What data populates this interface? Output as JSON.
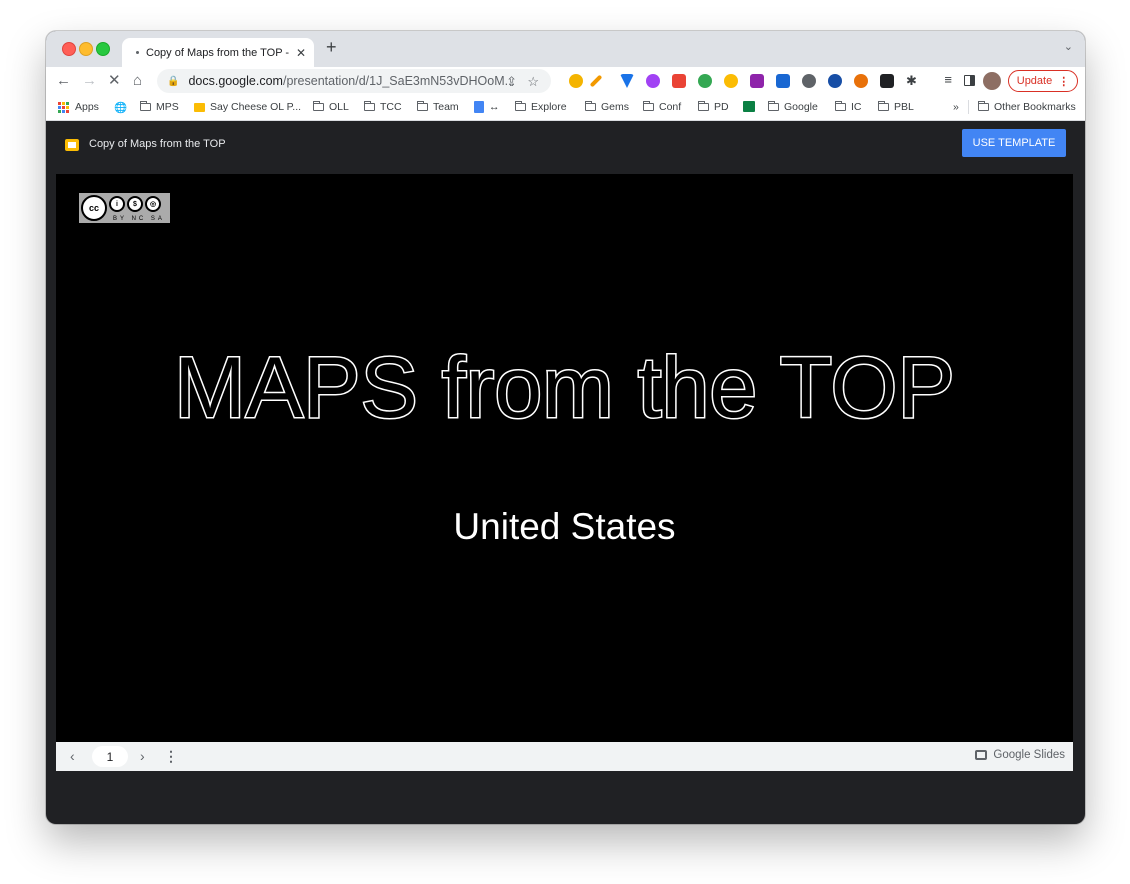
{
  "browser": {
    "tab_title": "Copy of Maps from the TOP - G",
    "tab_close": "✕",
    "new_tab": "+",
    "tab_menu": "⌄",
    "url_host": "docs.google.com",
    "url_path": "/presentation/d/1J_SaE3mN53vDHOoM...",
    "update_label": "Update",
    "update_menu": "⋮"
  },
  "bookmarks": {
    "apps": "Apps",
    "items": [
      "MPS",
      "Say Cheese OL P...",
      "OLL",
      "TCC",
      "Team",
      "↔",
      "Explore",
      "Gems",
      "Conf",
      "PD",
      "Google",
      "IC",
      "PBL"
    ],
    "overflow": "»",
    "other": "Other Bookmarks"
  },
  "app": {
    "doc_title": "Copy of Maps from the TOP",
    "use_template": "USE TEMPLATE"
  },
  "slide": {
    "title": "MAPS from the TOP",
    "subtitle": "United States",
    "cc_text": "BY NC SA"
  },
  "controls": {
    "page": "1",
    "brand": "Google Slides"
  },
  "colors": {
    "accent": "#4285f4",
    "update_red": "#d93025",
    "slides_yellow": "#fbbc04"
  }
}
